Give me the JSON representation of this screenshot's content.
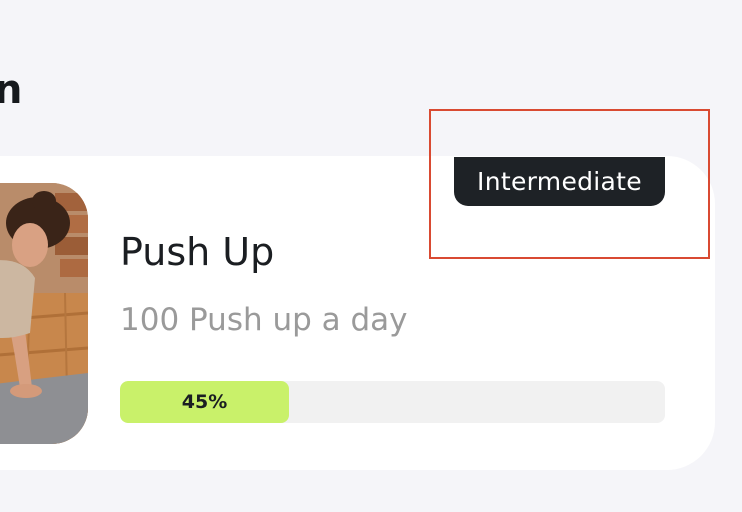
{
  "header": {
    "title_fragment": "n"
  },
  "workout_card": {
    "level_badge": "Intermediate",
    "title": "Push Up",
    "subtitle": "100 Push up a day",
    "progress": {
      "percent": 45,
      "label": "45%",
      "fill_color": "#c9f16a",
      "track_color": "#f1f1f1"
    },
    "photo_icon": "woman-doing-push-up-photo"
  },
  "colors": {
    "badge_bg": "#1e2226",
    "highlight_border": "#d94a32",
    "page_bg": "#f5f5f9"
  }
}
